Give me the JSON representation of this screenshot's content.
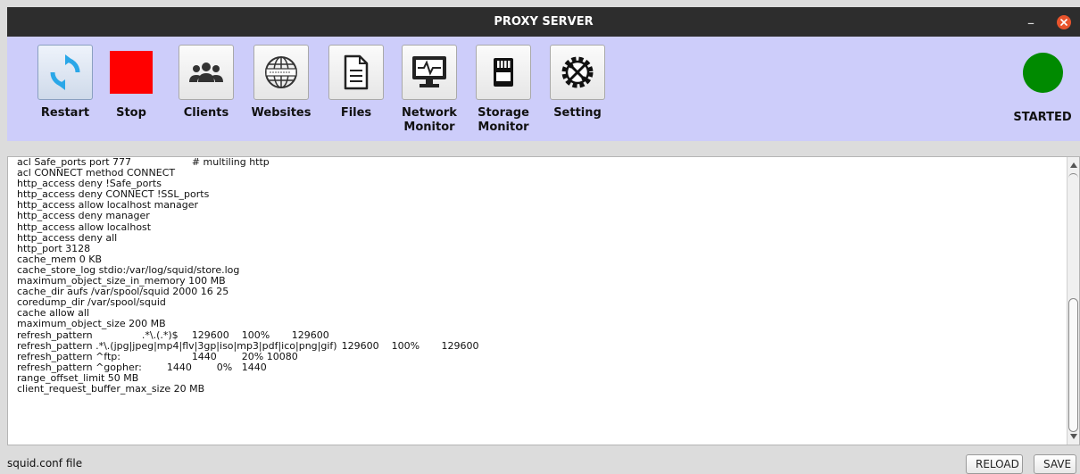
{
  "window": {
    "title": "PROXY SERVER"
  },
  "toolbar": {
    "buttons": [
      {
        "label": "Restart",
        "icon": "refresh-icon"
      },
      {
        "label": "Stop",
        "icon": "stop-icon"
      },
      {
        "label": "Clients",
        "icon": "users-icon"
      },
      {
        "label": "Websites",
        "icon": "globe-icon"
      },
      {
        "label": "Files",
        "icon": "file-icon"
      },
      {
        "label": "Network\nMonitor",
        "icon": "network-monitor-icon"
      },
      {
        "label": "Storage\nMonitor",
        "icon": "sd-card-icon"
      },
      {
        "label": "Setting",
        "icon": "settings-icon"
      }
    ],
    "status": {
      "label": "STARTED",
      "color": "#008a00"
    }
  },
  "editor": {
    "content": "acl Safe_ports port 777\t\t\t# multiling http\nacl CONNECT method CONNECT\nhttp_access deny !Safe_ports\nhttp_access deny CONNECT !SSL_ports\nhttp_access allow localhost manager\nhttp_access deny manager\nhttp_access allow localhost\nhttp_access deny all\nhttp_port 3128\ncache_mem 0 KB\ncache_store_log stdio:/var/log/squid/store.log\nmaximum_object_size_in_memory 100 MB\ncache_dir aufs /var/spool/squid 2000 16 25\ncoredump_dir /var/spool/squid\ncache allow all\nmaximum_object_size 200 MB\nrefresh_pattern\t\t.*\\.(.*)$\t129600\t100%\t129600\nrefresh_pattern .*\\.(jpg|jpeg|mp4|flv|3gp|iso|mp3|pdf|ico|png|gif)\t129600\t100%\t129600\nrefresh_pattern ^ftp:\t\t\t1440\t20%\t10080\nrefresh_pattern ^gopher:\t1440\t0%\t1440\nrange_offset_limit 50 MB\nclient_request_buffer_max_size 20 MB"
  },
  "footer": {
    "file_label": "squid.conf  file",
    "reload_label": "RELOAD",
    "save_label": "SAVE"
  }
}
